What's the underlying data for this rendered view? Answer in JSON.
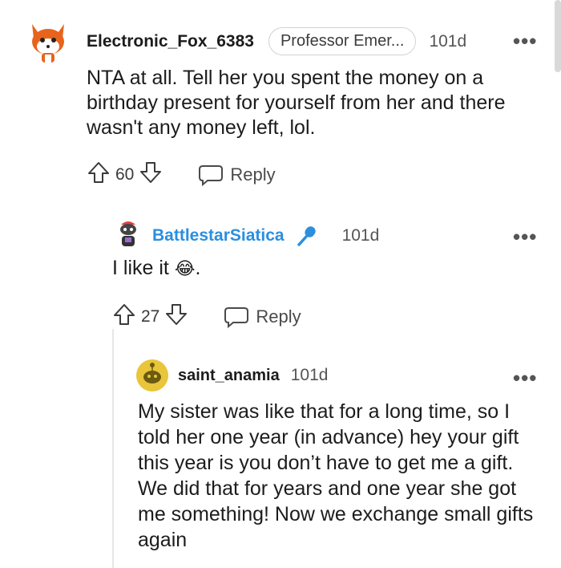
{
  "comments": [
    {
      "username": "Electronic_Fox_6383",
      "flair": "Professor Emer...",
      "time": "101d",
      "text": "NTA at all. Tell her you spent the money on a birthday present for yourself from her and there wasn't any money left, lol.",
      "votes": "60",
      "reply_label": "Reply",
      "avatar_icon": "fox-avatar-icon"
    },
    {
      "username": "BattlestarSiatica",
      "badge_icon": "microphone-icon",
      "time": "101d",
      "text": "I like it",
      "text_suffix": ".",
      "emoji": "😂",
      "votes": "27",
      "reply_label": "Reply",
      "avatar_icon": "snoo-avatar-icon"
    },
    {
      "username": "saint_anamia",
      "time": "101d",
      "text": "My sister was like that for a long time, so I told her one year (in advance) hey your gift this year is you don’t have to get me a gift. We did that for years and one year she got me something! Now we exchange small gifts again",
      "avatar_icon": "yellow-snoo-avatar-icon"
    }
  ],
  "more_glyph": "•••",
  "colors": {
    "accent_blue": "#2a8fe0",
    "text": "#1c1c1c",
    "muted": "#555555"
  }
}
